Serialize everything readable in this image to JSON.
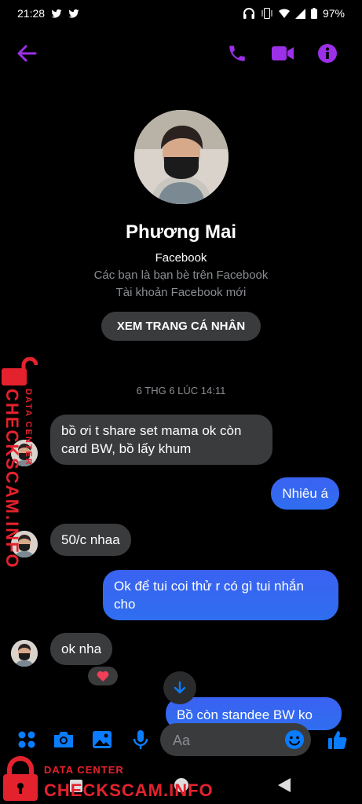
{
  "status": {
    "time": "21:28",
    "battery": "97%"
  },
  "profile": {
    "name": "Phương Mai",
    "source": "Facebook",
    "friends_note": "Các bạn là bạn bè trên Facebook",
    "account_note": "Tài khoản Facebook mới",
    "view_profile_label": "XEM TRANG CÁ NHÂN"
  },
  "chat": {
    "date": "6 THG 6 LÚC 14:11",
    "messages": [
      {
        "from": "them",
        "text": "bồ ơi t share set mama ok còn card BW, bồ lấy khum"
      },
      {
        "from": "me",
        "text": "Nhiêu á"
      },
      {
        "from": "them",
        "text": "50/c nhaa"
      },
      {
        "from": "me",
        "text": "Ok để tui coi thử r có gì tui nhắn cho"
      },
      {
        "from": "them",
        "text": "ok nha"
      },
      {
        "from": "me",
        "text": "Bồ còn standee BW ko"
      }
    ],
    "reaction": "heart"
  },
  "composer": {
    "placeholder": "Aa"
  },
  "watermark": {
    "small": "DATA CENTER",
    "big": "CHECKSCAM.INFO"
  },
  "colors": {
    "accent": "#9b30e8",
    "blue": "#0a7cff",
    "bubble_in": "#3a3b3c",
    "watermark": "#e4222d"
  }
}
